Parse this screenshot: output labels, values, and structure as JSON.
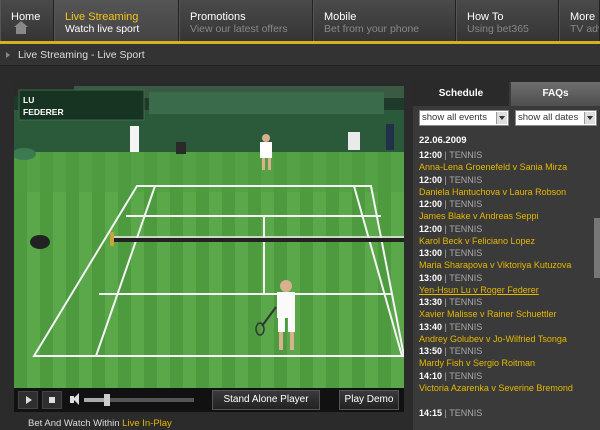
{
  "nav": {
    "items": [
      {
        "title": "Home",
        "subtitle": ""
      },
      {
        "title": "Live Streaming",
        "subtitle": "Watch live sport"
      },
      {
        "title": "Promotions",
        "subtitle": "View our latest offers"
      },
      {
        "title": "Mobile",
        "subtitle": "Bet from your phone"
      },
      {
        "title": "How To",
        "subtitle": "Using bet365"
      },
      {
        "title": "More",
        "subtitle": "TV adv"
      }
    ],
    "accent": "#d6b21a"
  },
  "breadcrumb": "Live Streaming - Live Sport",
  "video": {
    "scoreboard": {
      "player1": "LU",
      "player2": "FEDERER"
    }
  },
  "player": {
    "standalone_label": "Stand Alone Player",
    "playdemo_label": "Play Demo",
    "volume_level": 0.2
  },
  "footer": {
    "text": "Bet And Watch Within",
    "link": "Live In-Play"
  },
  "panel": {
    "tabs": {
      "schedule": "Schedule",
      "faqs": "FAQs"
    },
    "filters": {
      "events": "show all events",
      "dates": "show all dates"
    },
    "date": "22.06.2009",
    "events": [
      {
        "time": "12:00",
        "sport": "TENNIS",
        "title": "Anna-Lena Groenefeld v Sania Mirza"
      },
      {
        "time": "12:00",
        "sport": "TENNIS",
        "title": "Daniela Hantuchova v Laura Robson"
      },
      {
        "time": "12:00",
        "sport": "TENNIS",
        "title": "James Blake v Andreas Seppi"
      },
      {
        "time": "12:00",
        "sport": "TENNIS",
        "title": "Karol Beck v Feliciano Lopez"
      },
      {
        "time": "13:00",
        "sport": "TENNIS",
        "title": "Maria Sharapova v Viktoriya Kutuzova"
      },
      {
        "time": "13:00",
        "sport": "TENNIS",
        "title": "Yen-Hsun Lu v Roger Federer"
      },
      {
        "time": "13:30",
        "sport": "TENNIS",
        "title": "Xavier Malisse v Rainer Schuettler"
      },
      {
        "time": "13:40",
        "sport": "TENNIS",
        "title": "Andrey Golubev v Jo-Wilfried Tsonga"
      },
      {
        "time": "13:50",
        "sport": "TENNIS",
        "title": "Mardy Fish v Sergio Roitman"
      },
      {
        "time": "14:10",
        "sport": "TENNIS",
        "title": "Victoria Azarenka v Severine Bremond"
      },
      {
        "time": "14:15",
        "sport": "TENNIS",
        "title": ""
      }
    ]
  }
}
